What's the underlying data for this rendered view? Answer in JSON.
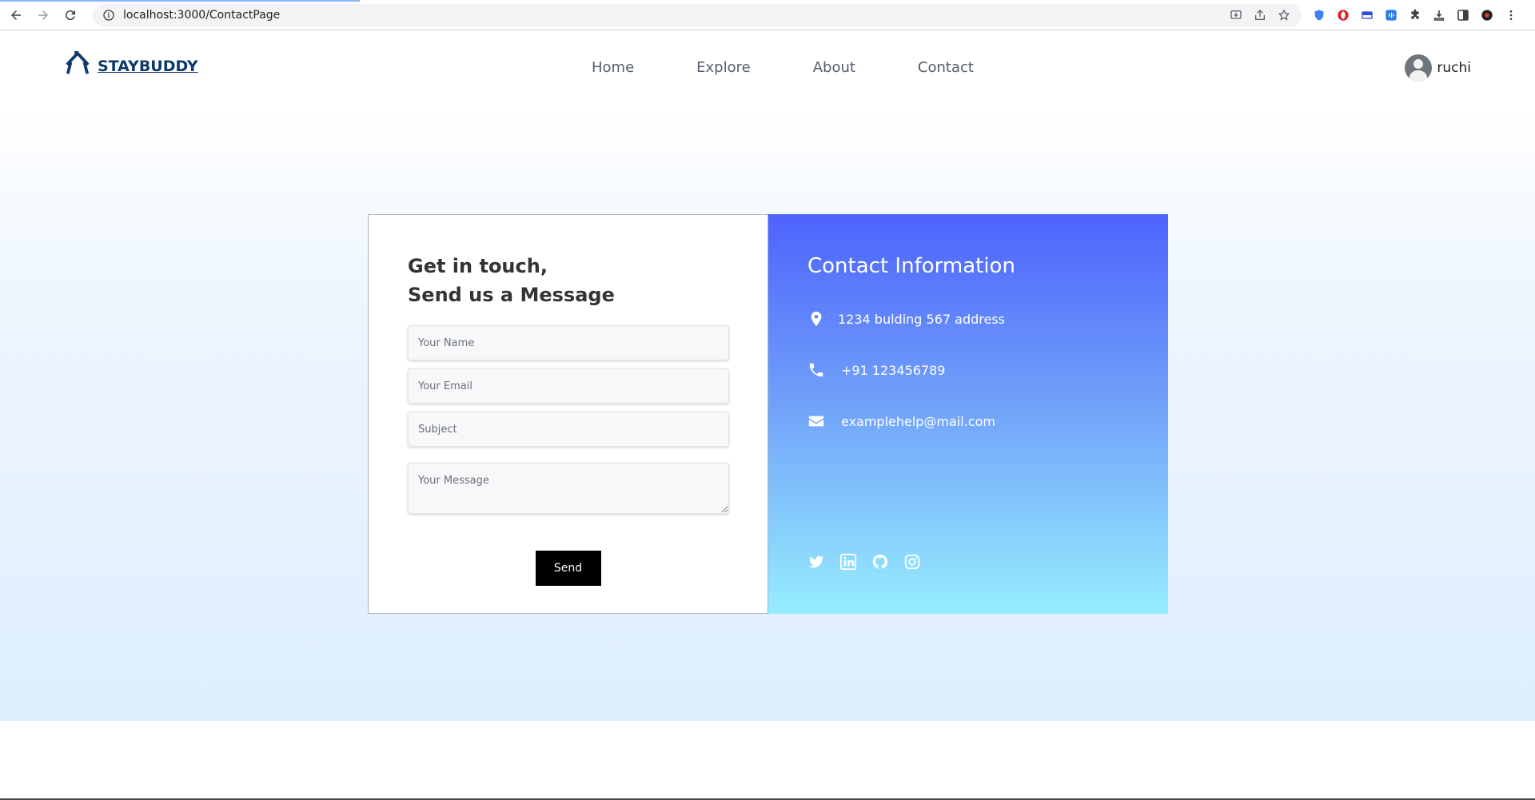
{
  "browser": {
    "url": "localhost:3000/ContactPage"
  },
  "header": {
    "logo_text": "STAYBUDDY",
    "nav": [
      "Home",
      "Explore",
      "About",
      "Contact"
    ],
    "user_name": "ruchi"
  },
  "form": {
    "title_line1": "Get in touch,",
    "title_line2": "Send us a Message",
    "name_placeholder": "Your Name",
    "email_placeholder": "Your Email",
    "subject_placeholder": "Subject",
    "message_placeholder": "Your Message",
    "send_label": "Send"
  },
  "contact": {
    "title": "Contact Information",
    "address": "1234 bulding 567 address",
    "phone": "+91 123456789",
    "email": "examplehelp@mail.com",
    "socials": [
      "twitter-icon",
      "linkedin-icon",
      "github-icon",
      "instagram-icon"
    ]
  },
  "colors": {
    "brand": "#0e3a6b",
    "info_gradient_top": "#4d63fd",
    "info_gradient_bottom": "#96edfe",
    "send_button": "#000000"
  }
}
